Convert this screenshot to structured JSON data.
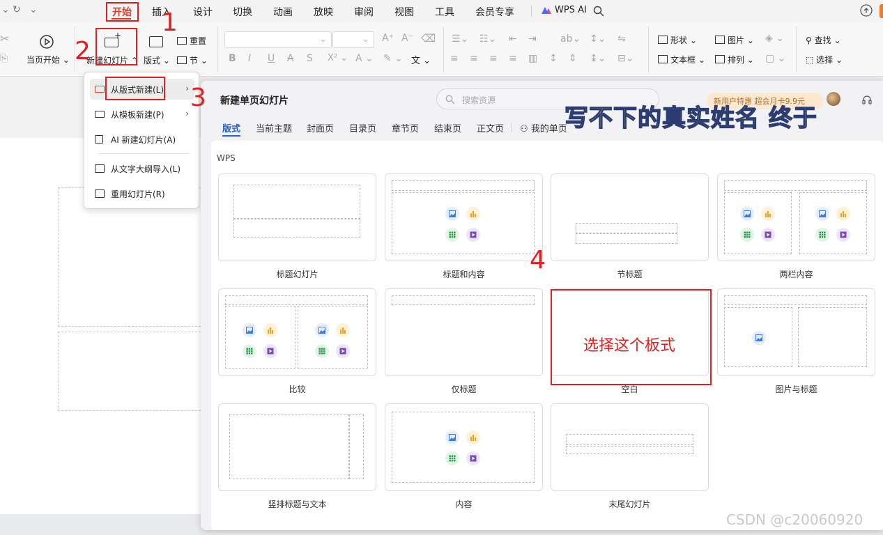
{
  "menubar": {
    "tabs": [
      "开始",
      "插入",
      "设计",
      "切换",
      "动画",
      "放映",
      "审阅",
      "视图",
      "工具",
      "会员专享"
    ],
    "wps_ai": "WPS AI",
    "active_tab": "开始"
  },
  "ribbon": {
    "from_current": "当页开始",
    "new_slide": "新建幻灯片",
    "layout": "版式",
    "reset": "重置",
    "section": "节",
    "shape": "形状",
    "picture": "图片",
    "textbox": "文本框",
    "arrange": "排列",
    "find": "查找",
    "select": "选择"
  },
  "dropdown": {
    "items": [
      {
        "label": "从版式新建(L)",
        "has_arrow": true
      },
      {
        "label": "从模板新建(P)",
        "has_arrow": true
      },
      {
        "label": "AI 新建幻灯片(A)",
        "has_arrow": false
      },
      {
        "label": "从文字大纲导入(L)",
        "has_arrow": false
      },
      {
        "label": "重用幻灯片(R)",
        "has_arrow": false
      }
    ]
  },
  "panel": {
    "title": "新建单页幻灯片",
    "search_placeholder": "搜索资源",
    "promo": "新用户特惠 超会月卡9.9元",
    "overlay_text": "写不下的真实姓名 终于",
    "tabs": [
      "版式",
      "当前主题",
      "封面页",
      "目录页",
      "章节页",
      "结束页",
      "正文页",
      "我的单页"
    ],
    "section_label": "WPS",
    "layouts": [
      "标题幻灯片",
      "标题和内容",
      "节标题",
      "两栏内容",
      "比较",
      "仅标题",
      "空白",
      "图片与标题",
      "竖排标题与文本",
      "内容",
      "末尾幻灯片"
    ]
  },
  "annotations": {
    "step1": "1",
    "step2": "2",
    "step3": "3",
    "step4": "4",
    "choose_text": "选择这个板式"
  },
  "watermark": "CSDN @c20060920",
  "colors": {
    "accent_red": "#e02020",
    "tab_blue": "#1f5fd6",
    "active_tab_red": "#e13a23"
  }
}
